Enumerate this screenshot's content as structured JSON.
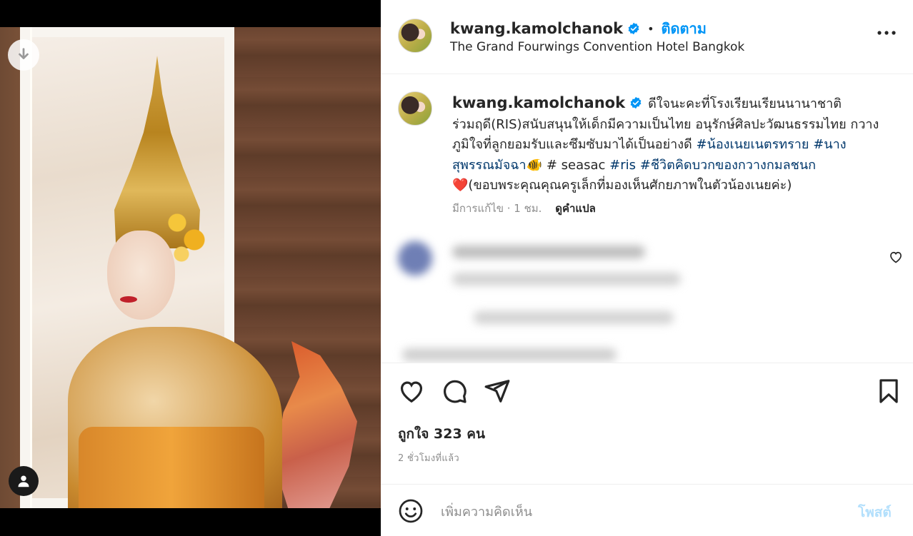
{
  "post": {
    "username": "kwang.kamolchanok",
    "follow_label": "ติดตาม",
    "dot": "•",
    "location": "The Grand Fourwings Convention Hotel Bangkok"
  },
  "caption": {
    "username": "kwang.kamolchanok",
    "text_1": "ดีใจนะคะที่โรงเรียนเรียนนานาชาติร่วมฤดี(RIS)สนับสนุนให้เด็กมีความเป็นไทย อนุรักษ์ศิลปะวัฒนธรรมไทย กวางภูมิใจที่ลูกยอมรับและซึมซับมาได้เป็นอย่างดี ",
    "tag_1": "#น้องเนยเนตรทราย",
    "space_1": " ",
    "tag_2": "#นางสุพรรณมัจฉา",
    "fish_emoji": "🐠",
    "text_2": " # seasac ",
    "tag_3": "#ris",
    "space_2": " ",
    "tag_4": "#ชีวิตคิดบวกของกวางกมลชนก",
    "heart_emoji": "❤️",
    "text_3": "(ขอบพระคุณคุณครูเล็กที่มองเห็นศักยภาพในตัวน้องเนยค่ะ)",
    "edited": "มีการแก้ไข · 1 ชม.",
    "translate": "ดูคำแปล"
  },
  "engagement": {
    "likes": "ถูกใจ 323 คน",
    "time_ago": "2 ชั่วโมงที่แล้ว"
  },
  "comment_box": {
    "placeholder": "เพิ่มความคิดเห็น",
    "post_label": "โพสต์"
  },
  "icons": {
    "download": "download-icon",
    "profile": "user-icon",
    "more": "more-icon",
    "verified": "verified-badge-icon",
    "like": "heart-icon",
    "comment": "comment-icon",
    "share": "share-icon",
    "save": "bookmark-icon",
    "emoji": "emoji-icon"
  },
  "colors": {
    "accent": "#0095f6",
    "hashtag": "#00376b",
    "post_disabled": "#b2dffc",
    "muted": "#8e8e8e"
  }
}
